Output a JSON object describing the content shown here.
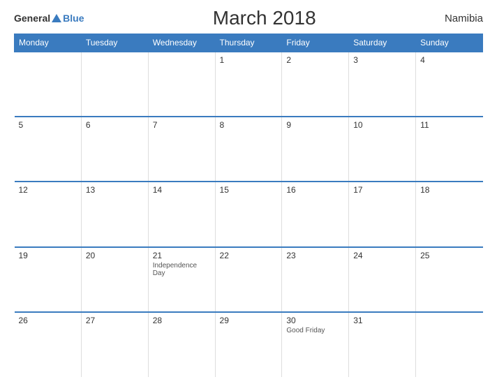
{
  "header": {
    "title": "March 2018",
    "country": "Namibia",
    "logo_general": "General",
    "logo_blue": "Blue"
  },
  "weekdays": [
    "Monday",
    "Tuesday",
    "Wednesday",
    "Thursday",
    "Friday",
    "Saturday",
    "Sunday"
  ],
  "weeks": [
    [
      {
        "day": "",
        "holiday": ""
      },
      {
        "day": "",
        "holiday": ""
      },
      {
        "day": "",
        "holiday": ""
      },
      {
        "day": "1",
        "holiday": ""
      },
      {
        "day": "2",
        "holiday": ""
      },
      {
        "day": "3",
        "holiday": ""
      },
      {
        "day": "4",
        "holiday": ""
      }
    ],
    [
      {
        "day": "5",
        "holiday": ""
      },
      {
        "day": "6",
        "holiday": ""
      },
      {
        "day": "7",
        "holiday": ""
      },
      {
        "day": "8",
        "holiday": ""
      },
      {
        "day": "9",
        "holiday": ""
      },
      {
        "day": "10",
        "holiday": ""
      },
      {
        "day": "11",
        "holiday": ""
      }
    ],
    [
      {
        "day": "12",
        "holiday": ""
      },
      {
        "day": "13",
        "holiday": ""
      },
      {
        "day": "14",
        "holiday": ""
      },
      {
        "day": "15",
        "holiday": ""
      },
      {
        "day": "16",
        "holiday": ""
      },
      {
        "day": "17",
        "holiday": ""
      },
      {
        "day": "18",
        "holiday": ""
      }
    ],
    [
      {
        "day": "19",
        "holiday": ""
      },
      {
        "day": "20",
        "holiday": ""
      },
      {
        "day": "21",
        "holiday": "Independence Day"
      },
      {
        "day": "22",
        "holiday": ""
      },
      {
        "day": "23",
        "holiday": ""
      },
      {
        "day": "24",
        "holiday": ""
      },
      {
        "day": "25",
        "holiday": ""
      }
    ],
    [
      {
        "day": "26",
        "holiday": ""
      },
      {
        "day": "27",
        "holiday": ""
      },
      {
        "day": "28",
        "holiday": ""
      },
      {
        "day": "29",
        "holiday": ""
      },
      {
        "day": "30",
        "holiday": "Good Friday"
      },
      {
        "day": "31",
        "holiday": ""
      },
      {
        "day": "",
        "holiday": ""
      }
    ]
  ]
}
